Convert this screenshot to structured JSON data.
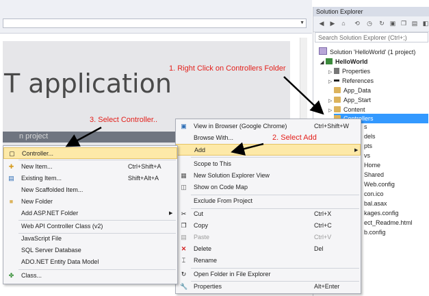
{
  "ide": {
    "start_title": "T application",
    "banner_text": "n project"
  },
  "solution_explorer": {
    "title": "Solution Explorer",
    "search_placeholder": "Search Solution Explorer (Ctrl+;)",
    "tree": [
      {
        "label": "Solution 'HelloWorld' (1 project)"
      },
      {
        "label": "HelloWorld"
      },
      {
        "label": "Properties"
      },
      {
        "label": "References"
      },
      {
        "label": "App_Data"
      },
      {
        "label": "App_Start"
      },
      {
        "label": "Content"
      },
      {
        "label": "Controllers"
      }
    ],
    "partial_items": [
      "s",
      "dels",
      "pts",
      "vs",
      "Home",
      "Shared",
      "Web.config",
      "con.ico",
      "bal.asax",
      "kages.config",
      "ect_Readme.html",
      "b.config"
    ]
  },
  "context_menu": {
    "items": [
      {
        "label": "View in Browser (Google Chrome)",
        "shortcut": "Ctrl+Shift+W"
      },
      {
        "label": "Browse With...",
        "shortcut": ""
      },
      {
        "label": "Add",
        "shortcut": ""
      },
      {
        "label": "Scope to This",
        "shortcut": ""
      },
      {
        "label": "New Solution Explorer View",
        "shortcut": ""
      },
      {
        "label": "Show on Code Map",
        "shortcut": ""
      },
      {
        "label": "Exclude From Project",
        "shortcut": ""
      },
      {
        "label": "Cut",
        "shortcut": "Ctrl+X"
      },
      {
        "label": "Copy",
        "shortcut": "Ctrl+C"
      },
      {
        "label": "Paste",
        "shortcut": "Ctrl+V"
      },
      {
        "label": "Delete",
        "shortcut": "Del"
      },
      {
        "label": "Rename",
        "shortcut": ""
      },
      {
        "label": "Open Folder in File Explorer",
        "shortcut": ""
      },
      {
        "label": "Properties",
        "shortcut": "Alt+Enter"
      }
    ]
  },
  "add_submenu": {
    "items": [
      {
        "label": "Controller...",
        "shortcut": ""
      },
      {
        "label": "New Item...",
        "shortcut": "Ctrl+Shift+A"
      },
      {
        "label": "Existing Item...",
        "shortcut": "Shift+Alt+A"
      },
      {
        "label": "New Scaffolded Item...",
        "shortcut": ""
      },
      {
        "label": "New Folder",
        "shortcut": ""
      },
      {
        "label": "Add ASP.NET Folder",
        "shortcut": ""
      },
      {
        "label": "Web API Controller Class (v2)",
        "shortcut": ""
      },
      {
        "label": "JavaScript File",
        "shortcut": ""
      },
      {
        "label": "SQL Server Database",
        "shortcut": ""
      },
      {
        "label": "ADO.NET Entity Data Model",
        "shortcut": ""
      },
      {
        "label": "Class...",
        "shortcut": ""
      }
    ]
  },
  "annotations": {
    "step1": "1. Right Click on Controllers Folder",
    "step2": "2. Select Add",
    "step3": "3. Select Controller.."
  },
  "colors": {
    "selection": "#3399ff",
    "highlight": "#fde9a8",
    "annotation": "#e3201b"
  }
}
